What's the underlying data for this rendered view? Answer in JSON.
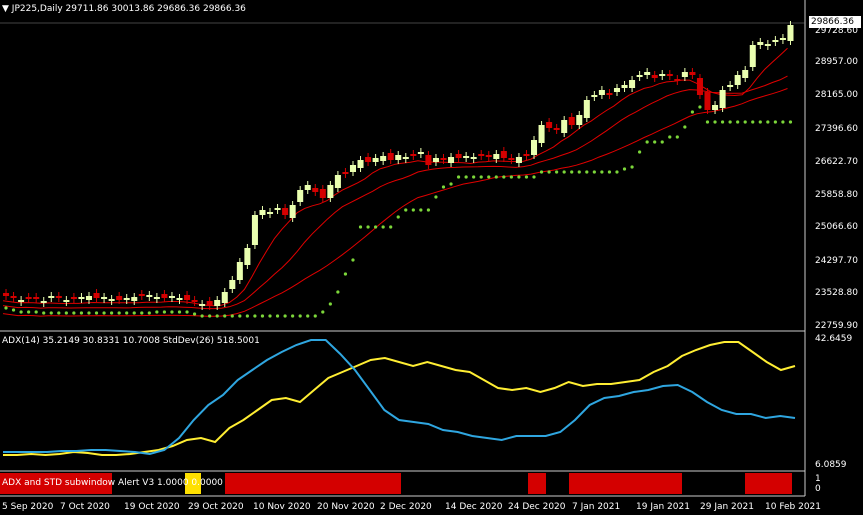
{
  "main_panel": {
    "header": "JP225,Daily  29711.86 30013.86 29686.36 29866.36",
    "current_price": "29866.36",
    "price_axis": [
      "29728.60",
      "28957.00",
      "28165.00",
      "27396.60",
      "26622.70",
      "25858.80",
      "25066.60",
      "24297.70",
      "23528.80",
      "22759.90"
    ]
  },
  "indicator_panel": {
    "header": "ADX(14) 35.2149 30.8331 10.7008  StdDev(26) 518.5001",
    "axis": [
      "42.6459",
      "6.0859"
    ]
  },
  "alert_panel": {
    "header": "ADX and STD subwindow Alert V3 1.0000 0.0000",
    "axis": [
      "1",
      "0"
    ]
  },
  "time_axis": [
    "5 Sep 2020",
    "7 Oct 2020",
    "19 Oct 2020",
    "29 Oct 2020",
    "10 Nov 2020",
    "20 Nov 2020",
    "2 Dec 2020",
    "14 Dec 2020",
    "24 Dec 2020",
    "7 Jan 2021",
    "19 Jan 2021",
    "29 Jan 2021",
    "10 Feb 2021"
  ],
  "colors": {
    "background": "#000000",
    "bear_candle": "#d40000",
    "bull_candle": "#eaffb0",
    "ma_lines": "#e00000",
    "trailing_stop": "#7cd63a",
    "adx_line": "#ffee33",
    "stddev_line": "#2fa6e0",
    "alert_on": "#d40000",
    "alert_mid": "#ffe000",
    "grid_border": "#ffffff"
  }
}
